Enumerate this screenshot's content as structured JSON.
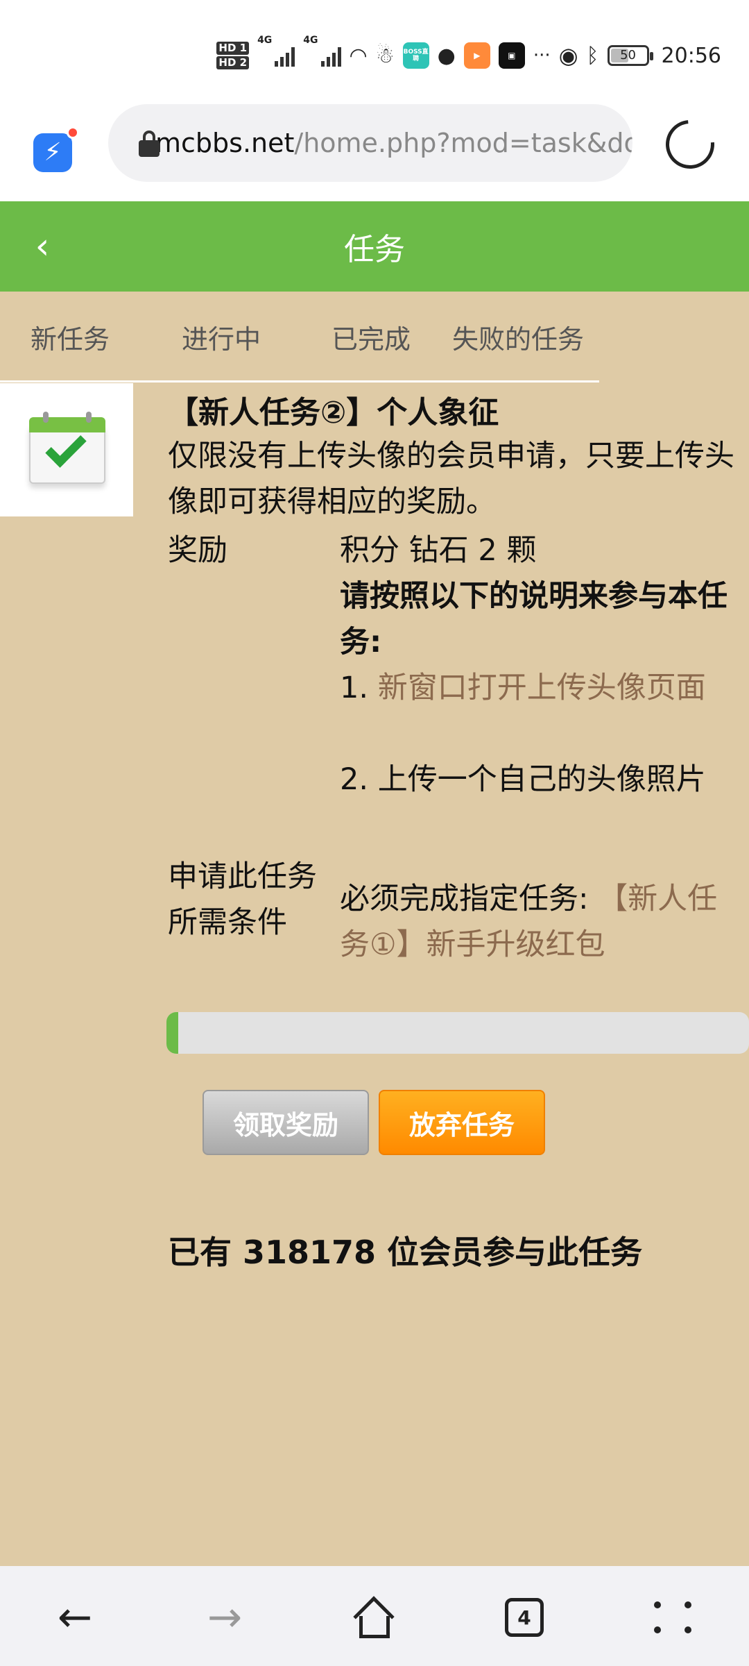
{
  "status_bar": {
    "sim1": "HD 1",
    "sim2": "HD 2",
    "net1": "4G",
    "net2": "4G",
    "boss_app": "BOSS直聘",
    "battery": "50",
    "time": "20:56",
    "overflow": "···"
  },
  "browser": {
    "url_host": "mcbbs.net",
    "url_path": "/home.php?mod=task&do="
  },
  "header": {
    "title": "任务"
  },
  "tabs": [
    {
      "label": "新任务"
    },
    {
      "label": "进行中"
    },
    {
      "label": "已完成"
    },
    {
      "label": "失败的任务"
    }
  ],
  "task": {
    "title": "【新人任务②】个人象征",
    "description": "仅限没有上传头像的会员申请，只要上传头像即可获得相应的奖励。",
    "reward_label": "奖励",
    "reward_value": "积分 钻石 2 颗",
    "instructions_heading": "请按照以下的说明来参与本任务:",
    "step1_prefix": "1. ",
    "step1_link": "新窗口打开上传头像页面",
    "step2": "2. 上传一个自己的头像照片",
    "condition_label": "申请此任务所需条件",
    "condition_prefix": "必须完成指定任务: ",
    "condition_link": "【新人任务①】新手升级红包",
    "progress_fraction": 0.02,
    "claim_button": "领取奖励",
    "abandon_button": "放弃任务",
    "participants": "已有 318178 位会员参与此任务"
  },
  "colors": {
    "background": "#dfcba6",
    "header": "#6cbb48",
    "link": "#8c6a4e",
    "abandon": "#ff9a10"
  },
  "navbar": {
    "tab_count": "4"
  }
}
